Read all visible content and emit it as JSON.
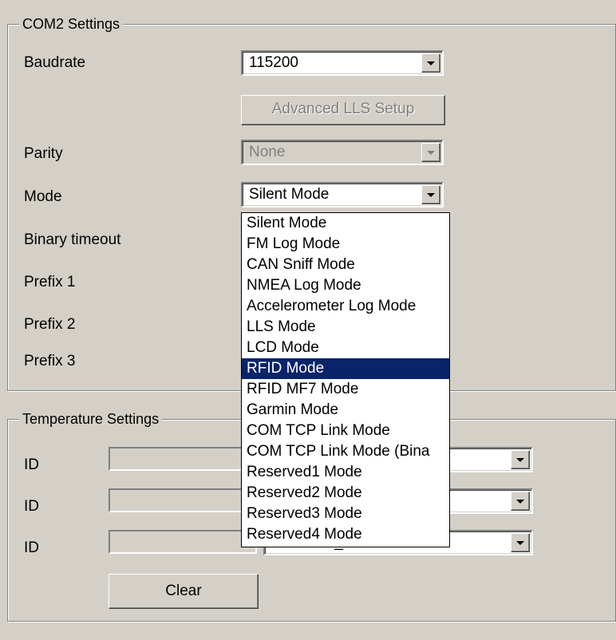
{
  "com2": {
    "title": "COM2 Settings",
    "baudrate_label": "Baudrate",
    "baudrate_value": "115200",
    "advanced_button": "Advanced LLS Setup",
    "parity_label": "Parity",
    "parity_value": "None",
    "mode_label": "Mode",
    "mode_value": "Silent Mode",
    "binary_timeout_label": "Binary timeout",
    "prefix1_label": "Prefix 1",
    "prefix2_label": "Prefix 2",
    "prefix3_label": "Prefix 3"
  },
  "mode_dropdown": {
    "options": [
      "Silent Mode",
      "FM Log Mode",
      "CAN Sniff Mode",
      "NMEA Log Mode",
      "Accelerometer Log Mode",
      "LLS Mode",
      "LCD Mode",
      "RFID Mode",
      "RFID MF7 Mode",
      "Garmin Mode",
      "COM TCP Link Mode",
      "COM TCP Link Mode (Bina",
      "Reserved1 Mode",
      "Reserved2 Mode",
      "Reserved3 Mode",
      "Reserved4 Mode"
    ],
    "highlighted": "RFID Mode"
  },
  "temperature": {
    "title": "Temperature Settings",
    "rows": [
      {
        "id_label": "ID",
        "sensor_value": ""
      },
      {
        "id_label": "ID",
        "sensor_value": ""
      },
      {
        "id_label": "ID",
        "sensor_value": "2 : Dallas_2"
      }
    ],
    "clear_button": "Clear"
  },
  "colors": {
    "face": "#d4d0c8",
    "highlight": "#0a246a",
    "disabled_text": "#808080"
  }
}
